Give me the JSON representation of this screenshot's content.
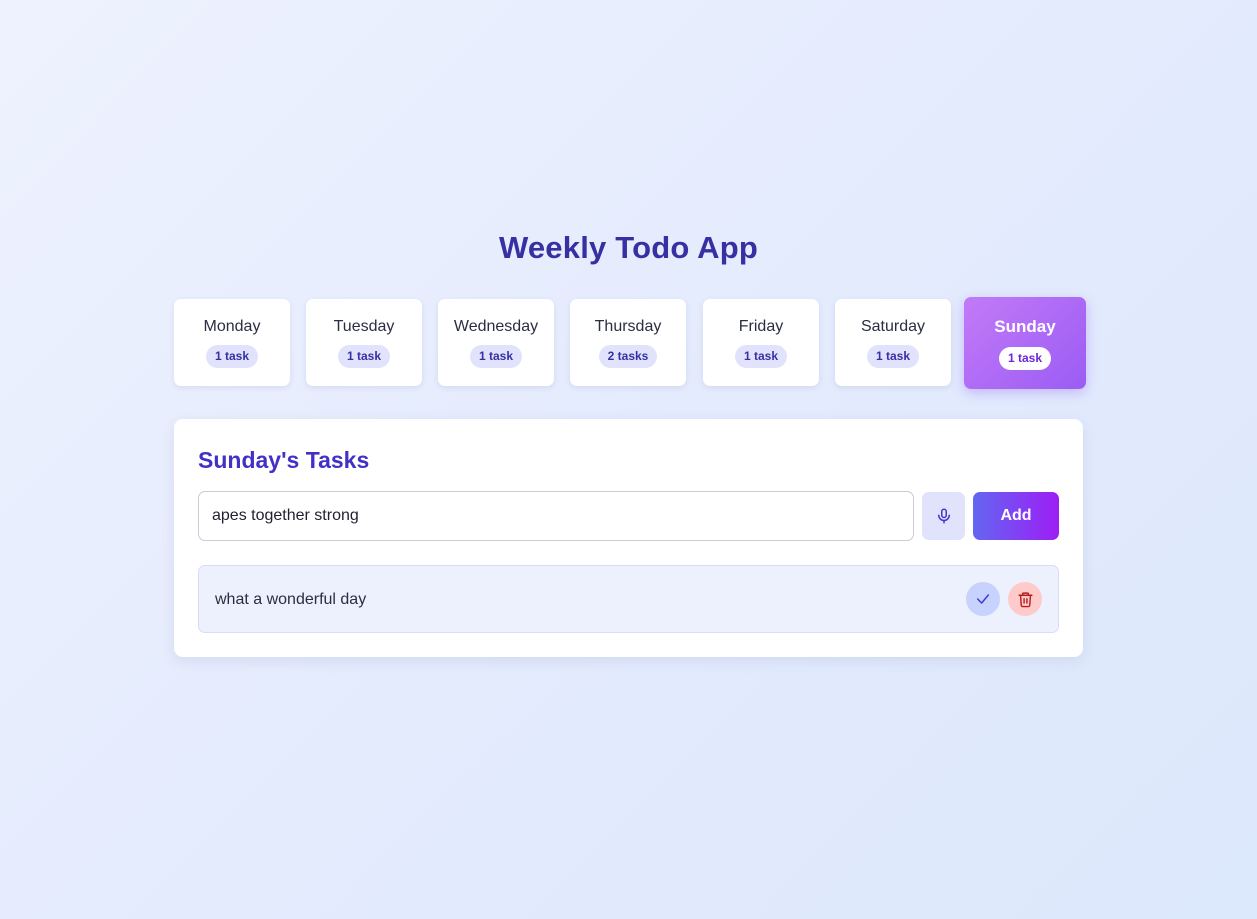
{
  "app": {
    "title": "Weekly Todo App"
  },
  "days": [
    {
      "name": "Monday",
      "count": "1 task"
    },
    {
      "name": "Tuesday",
      "count": "1 task"
    },
    {
      "name": "Wednesday",
      "count": "1 task"
    },
    {
      "name": "Thursday",
      "count": "2 tasks"
    },
    {
      "name": "Friday",
      "count": "1 task"
    },
    {
      "name": "Saturday",
      "count": "1 task"
    },
    {
      "name": "Sunday",
      "count": "1 task",
      "selected": true
    }
  ],
  "panel": {
    "title": "Sunday's Tasks",
    "input_value": "apes together strong",
    "mic_icon": "microphone-icon",
    "add_label": "Add"
  },
  "tasks": [
    {
      "text": "what a wonderful day",
      "complete_icon": "check-icon",
      "delete_icon": "trash-icon"
    }
  ],
  "colors": {
    "accent": "#3730a3",
    "selected_day_gradient": [
      "#c27af7",
      "#9b5cf4"
    ],
    "add_button_gradient": [
      "#6366f1",
      "#9d1ef5"
    ],
    "complete_bg": "#c7d2fe",
    "delete_bg": "#fecaca"
  }
}
